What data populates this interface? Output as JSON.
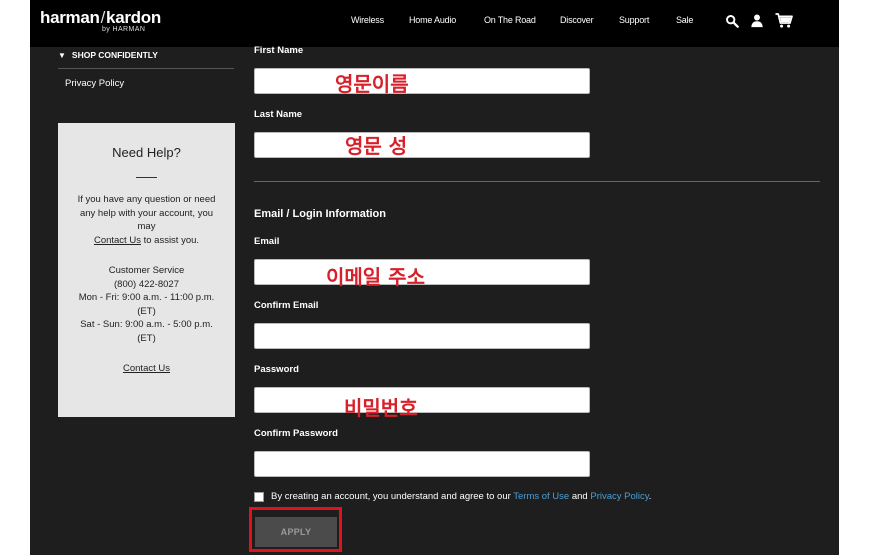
{
  "header": {
    "logo_main_left": "harman",
    "logo_slash": "/",
    "logo_main_right": "kardon",
    "logo_sub": "by HARMAN",
    "nav": [
      "Wireless",
      "Home Audio",
      "On The Road",
      "Discover",
      "Support",
      "Sale"
    ],
    "icons": [
      "search-icon",
      "user-icon",
      "cart-icon"
    ]
  },
  "sidebar": {
    "heading": "SHOP CONFIDENTLY",
    "links": [
      "Privacy Policy"
    ],
    "help": {
      "title": "Need Help?",
      "text_line1": "If you have any question or need",
      "text_line2": "any help with your account, you",
      "text_line3": "may",
      "contact_link_inline": "Contact Us",
      "text_after_link": " to assist you.",
      "cs_title": "Customer Service",
      "cs_phone": "(800) 422-8027",
      "cs_hours_weekday_1": "Mon - Fri: 9:00 a.m. - 11:00 p.m.",
      "cs_hours_weekday_2": "(ET)",
      "cs_hours_weekend_1": "Sat - Sun: 9:00 a.m. - 5:00 p.m.",
      "cs_hours_weekend_2": "(ET)",
      "contact_link": "Contact Us"
    }
  },
  "form": {
    "first_name_label": "First Name",
    "last_name_label": "Last Name",
    "section_title": "Email / Login Information",
    "email_label": "Email",
    "confirm_email_label": "Confirm Email",
    "password_label": "Password",
    "confirm_password_label": "Confirm Password",
    "agree_prefix": "By creating an account, you understand and agree to our ",
    "agree_terms": "Terms of Use",
    "agree_and": " and ",
    "agree_privacy": "Privacy Policy",
    "agree_suffix": ".",
    "apply_label": "APPLY"
  },
  "annotations": {
    "first_name": "영문이름",
    "last_name": "영문 성",
    "email": "이메일 주소",
    "password": "비밀번호"
  },
  "colors": {
    "background": "#1e1e1e",
    "header": "#000000",
    "annotation": "#d8202a",
    "link": "#4a9fd6"
  }
}
